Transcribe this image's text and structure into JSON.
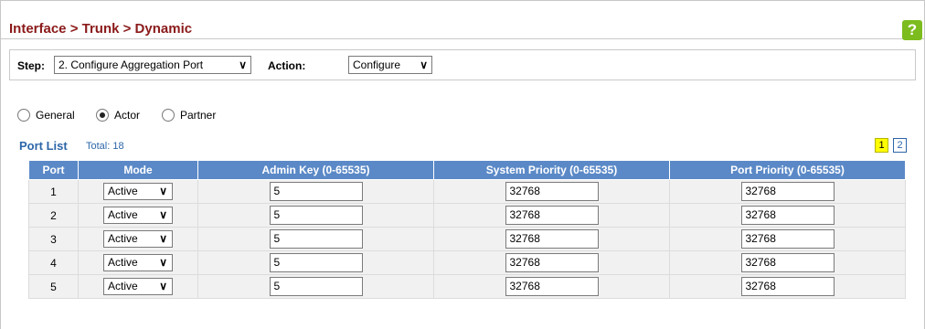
{
  "header": {
    "title": "Interface > Trunk > Dynamic",
    "help_icon": "?"
  },
  "step_bar": {
    "step_label": "Step:",
    "step_value": "2. Configure Aggregation Port",
    "action_label": "Action:",
    "action_value": "Configure"
  },
  "radios": [
    {
      "label": "General",
      "checked": false
    },
    {
      "label": "Actor",
      "checked": true
    },
    {
      "label": "Partner",
      "checked": false
    }
  ],
  "port_list": {
    "title": "Port List",
    "total": "Total: 18",
    "pages": [
      "1",
      "2"
    ],
    "active_page": "1"
  },
  "table": {
    "headers": [
      "Port",
      "Mode",
      "Admin Key (0-65535)",
      "System Priority (0-65535)",
      "Port Priority (0-65535)"
    ],
    "rows": [
      {
        "port": "1",
        "mode": "Active",
        "admin_key": "5",
        "system_priority": "32768",
        "port_priority": "32768"
      },
      {
        "port": "2",
        "mode": "Active",
        "admin_key": "5",
        "system_priority": "32768",
        "port_priority": "32768"
      },
      {
        "port": "3",
        "mode": "Active",
        "admin_key": "5",
        "system_priority": "32768",
        "port_priority": "32768"
      },
      {
        "port": "4",
        "mode": "Active",
        "admin_key": "5",
        "system_priority": "32768",
        "port_priority": "32768"
      },
      {
        "port": "5",
        "mode": "Active",
        "admin_key": "5",
        "system_priority": "32768",
        "port_priority": "32768"
      }
    ]
  },
  "colors": {
    "title": "#8b1a1a",
    "header_bg": "#5b89c7",
    "accent": "#2c66a8",
    "help_bg": "#7cbc1e"
  }
}
